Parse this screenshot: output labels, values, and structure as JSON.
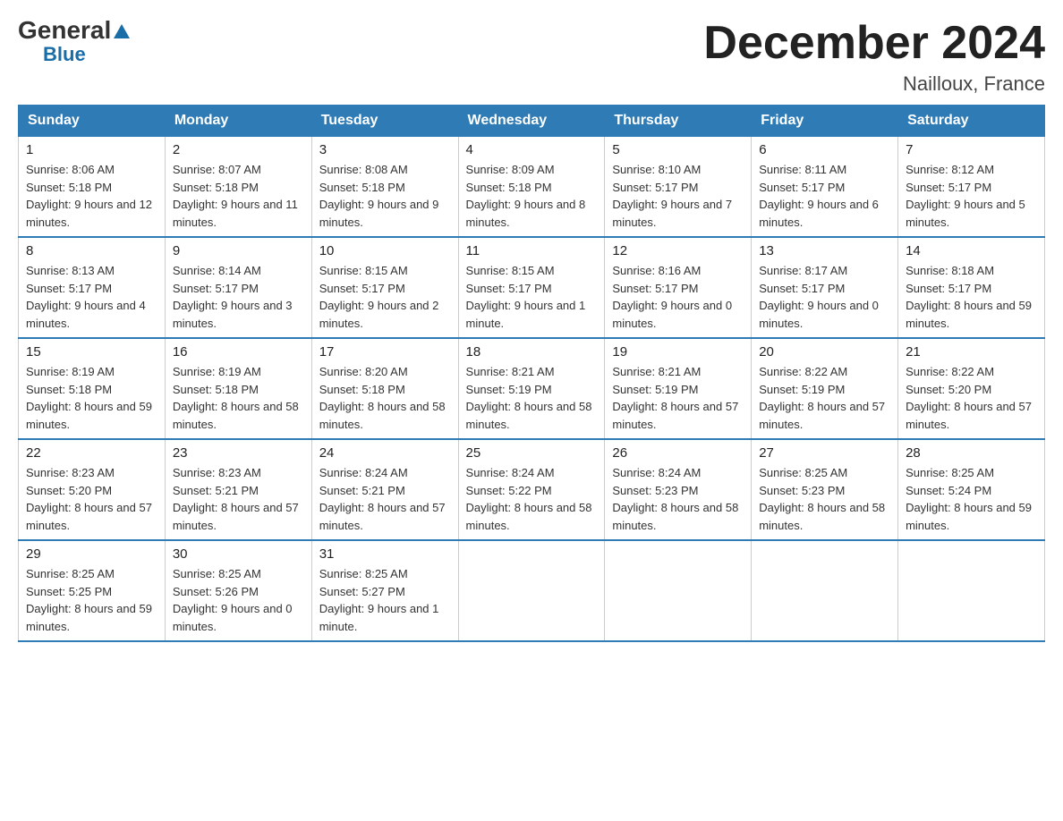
{
  "header": {
    "logo_general": "General",
    "logo_blue": "Blue",
    "title": "December 2024",
    "subtitle": "Nailloux, France"
  },
  "days_of_week": [
    "Sunday",
    "Monday",
    "Tuesday",
    "Wednesday",
    "Thursday",
    "Friday",
    "Saturday"
  ],
  "weeks": [
    [
      {
        "day": "1",
        "sunrise": "8:06 AM",
        "sunset": "5:18 PM",
        "daylight": "9 hours and 12 minutes."
      },
      {
        "day": "2",
        "sunrise": "8:07 AM",
        "sunset": "5:18 PM",
        "daylight": "9 hours and 11 minutes."
      },
      {
        "day": "3",
        "sunrise": "8:08 AM",
        "sunset": "5:18 PM",
        "daylight": "9 hours and 9 minutes."
      },
      {
        "day": "4",
        "sunrise": "8:09 AM",
        "sunset": "5:18 PM",
        "daylight": "9 hours and 8 minutes."
      },
      {
        "day": "5",
        "sunrise": "8:10 AM",
        "sunset": "5:17 PM",
        "daylight": "9 hours and 7 minutes."
      },
      {
        "day": "6",
        "sunrise": "8:11 AM",
        "sunset": "5:17 PM",
        "daylight": "9 hours and 6 minutes."
      },
      {
        "day": "7",
        "sunrise": "8:12 AM",
        "sunset": "5:17 PM",
        "daylight": "9 hours and 5 minutes."
      }
    ],
    [
      {
        "day": "8",
        "sunrise": "8:13 AM",
        "sunset": "5:17 PM",
        "daylight": "9 hours and 4 minutes."
      },
      {
        "day": "9",
        "sunrise": "8:14 AM",
        "sunset": "5:17 PM",
        "daylight": "9 hours and 3 minutes."
      },
      {
        "day": "10",
        "sunrise": "8:15 AM",
        "sunset": "5:17 PM",
        "daylight": "9 hours and 2 minutes."
      },
      {
        "day": "11",
        "sunrise": "8:15 AM",
        "sunset": "5:17 PM",
        "daylight": "9 hours and 1 minute."
      },
      {
        "day": "12",
        "sunrise": "8:16 AM",
        "sunset": "5:17 PM",
        "daylight": "9 hours and 0 minutes."
      },
      {
        "day": "13",
        "sunrise": "8:17 AM",
        "sunset": "5:17 PM",
        "daylight": "9 hours and 0 minutes."
      },
      {
        "day": "14",
        "sunrise": "8:18 AM",
        "sunset": "5:17 PM",
        "daylight": "8 hours and 59 minutes."
      }
    ],
    [
      {
        "day": "15",
        "sunrise": "8:19 AM",
        "sunset": "5:18 PM",
        "daylight": "8 hours and 59 minutes."
      },
      {
        "day": "16",
        "sunrise": "8:19 AM",
        "sunset": "5:18 PM",
        "daylight": "8 hours and 58 minutes."
      },
      {
        "day": "17",
        "sunrise": "8:20 AM",
        "sunset": "5:18 PM",
        "daylight": "8 hours and 58 minutes."
      },
      {
        "day": "18",
        "sunrise": "8:21 AM",
        "sunset": "5:19 PM",
        "daylight": "8 hours and 58 minutes."
      },
      {
        "day": "19",
        "sunrise": "8:21 AM",
        "sunset": "5:19 PM",
        "daylight": "8 hours and 57 minutes."
      },
      {
        "day": "20",
        "sunrise": "8:22 AM",
        "sunset": "5:19 PM",
        "daylight": "8 hours and 57 minutes."
      },
      {
        "day": "21",
        "sunrise": "8:22 AM",
        "sunset": "5:20 PM",
        "daylight": "8 hours and 57 minutes."
      }
    ],
    [
      {
        "day": "22",
        "sunrise": "8:23 AM",
        "sunset": "5:20 PM",
        "daylight": "8 hours and 57 minutes."
      },
      {
        "day": "23",
        "sunrise": "8:23 AM",
        "sunset": "5:21 PM",
        "daylight": "8 hours and 57 minutes."
      },
      {
        "day": "24",
        "sunrise": "8:24 AM",
        "sunset": "5:21 PM",
        "daylight": "8 hours and 57 minutes."
      },
      {
        "day": "25",
        "sunrise": "8:24 AM",
        "sunset": "5:22 PM",
        "daylight": "8 hours and 58 minutes."
      },
      {
        "day": "26",
        "sunrise": "8:24 AM",
        "sunset": "5:23 PM",
        "daylight": "8 hours and 58 minutes."
      },
      {
        "day": "27",
        "sunrise": "8:25 AM",
        "sunset": "5:23 PM",
        "daylight": "8 hours and 58 minutes."
      },
      {
        "day": "28",
        "sunrise": "8:25 AM",
        "sunset": "5:24 PM",
        "daylight": "8 hours and 59 minutes."
      }
    ],
    [
      {
        "day": "29",
        "sunrise": "8:25 AM",
        "sunset": "5:25 PM",
        "daylight": "8 hours and 59 minutes."
      },
      {
        "day": "30",
        "sunrise": "8:25 AM",
        "sunset": "5:26 PM",
        "daylight": "9 hours and 0 minutes."
      },
      {
        "day": "31",
        "sunrise": "8:25 AM",
        "sunset": "5:27 PM",
        "daylight": "9 hours and 1 minute."
      },
      null,
      null,
      null,
      null
    ]
  ]
}
